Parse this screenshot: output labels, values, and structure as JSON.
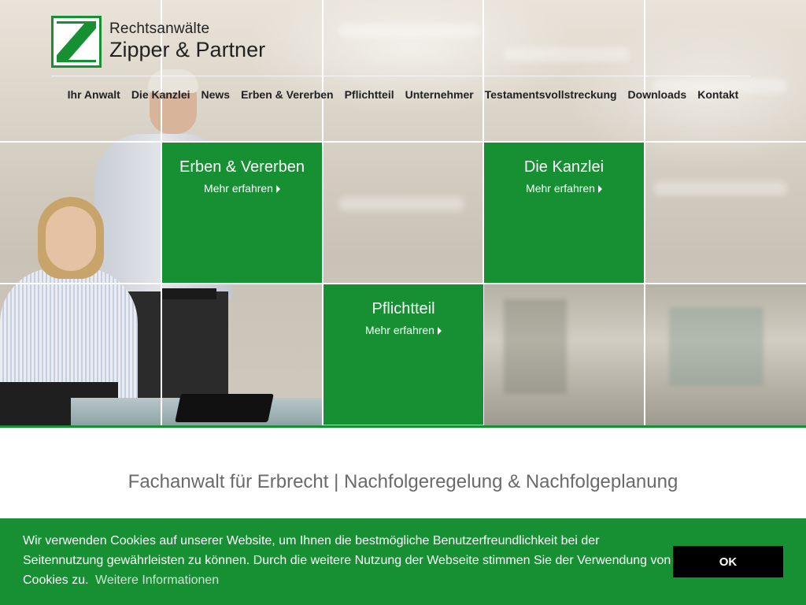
{
  "logo": {
    "line1": "Rechtsanwälte",
    "line2": "Zipper & Partner",
    "letter": "Z"
  },
  "nav": [
    "Ihr Anwalt",
    "Die Kanzlei",
    "News",
    "Erben & Vererben",
    "Pflichtteil",
    "Unternehmer",
    "Testamentsvollstreckung",
    "Downloads",
    "Kontakt"
  ],
  "tiles": [
    {
      "title": "Erben & Vererben",
      "link": "Mehr erfahren"
    },
    {
      "title": "Die Kanzlei",
      "link": "Mehr erfahren"
    },
    {
      "title": "Pflichtteil",
      "link": "Mehr erfahren"
    }
  ],
  "headline": "Fachanwalt für Erbrecht | Nachfolgeregelung & Nachfolgeplanung",
  "cookie": {
    "text": "Wir verwenden Cookies auf unserer Website, um Ihnen die bestmögliche Benutzerfreundlichkeit bei der Seitennutzung gewährleisten zu können. Durch die weitere Nutzung der Webseite stimmen Sie der Verwendung von Cookies zu.",
    "more": "Weitere Informationen",
    "ok": "OK"
  },
  "colors": {
    "brand_green": "#169033",
    "button_black": "#000000"
  }
}
